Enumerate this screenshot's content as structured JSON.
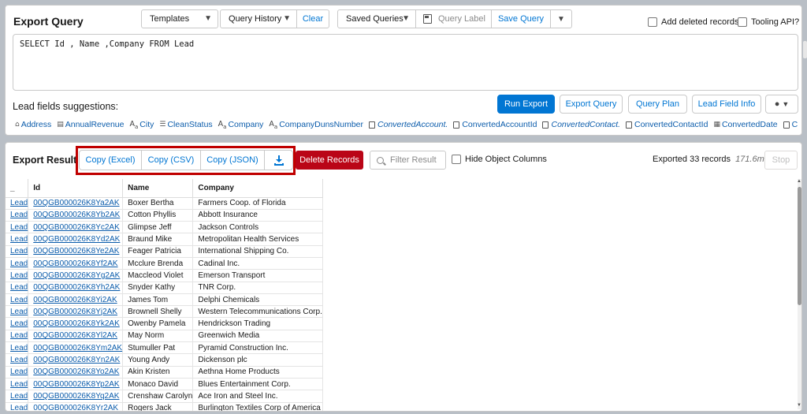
{
  "header": {
    "title": "Export Query",
    "templates": "Templates",
    "query_history": "Query History",
    "clear": "Clear",
    "saved_queries": "Saved Queries",
    "query_label_placeholder": "Query Label",
    "save_query": "Save Query",
    "add_deleted": "Add deleted records?",
    "tooling_api": "Tooling API?"
  },
  "editor": {
    "query": "SELECT Id , Name ,Company FROM Lead"
  },
  "suggestions": {
    "title": "Lead fields suggestions:",
    "buttons": {
      "run_export": "Run Export",
      "export_query": "Export Query",
      "query_plan": "Query Plan",
      "lead_field_info": "Lead Field Info"
    },
    "fields": [
      {
        "label": "Address",
        "icon": "home-icon",
        "italic": false
      },
      {
        "label": "AnnualRevenue",
        "icon": "currency-icon",
        "italic": false
      },
      {
        "label": "City",
        "icon": "text-icon",
        "italic": false
      },
      {
        "label": "CleanStatus",
        "icon": "picklist-icon",
        "italic": false
      },
      {
        "label": "Company",
        "icon": "text-icon",
        "italic": false
      },
      {
        "label": "CompanyDunsNumber",
        "icon": "text-icon",
        "italic": false
      },
      {
        "label": "ConvertedAccount.",
        "icon": "reference-icon",
        "italic": true
      },
      {
        "label": "ConvertedAccountId",
        "icon": "reference-icon",
        "italic": false
      },
      {
        "label": "ConvertedContact.",
        "icon": "reference-icon",
        "italic": true
      },
      {
        "label": "ConvertedContactId",
        "icon": "reference-icon",
        "italic": false
      },
      {
        "label": "ConvertedDate",
        "icon": "date-icon",
        "italic": false
      },
      {
        "label": "C",
        "icon": "reference-icon",
        "italic": false
      }
    ]
  },
  "result": {
    "title": "Export Result",
    "copy_excel": "Copy (Excel)",
    "copy_csv": "Copy (CSV)",
    "copy_json": "Copy (JSON)",
    "delete_records": "Delete Records",
    "filter_placeholder": "Filter Result",
    "hide_object_columns": "Hide Object Columns",
    "status": "Exported 33 records",
    "time": "171.6ms",
    "stop": "Stop",
    "columns": [
      "_",
      "Id",
      "Name",
      "Company"
    ],
    "rows": [
      [
        "Lead",
        "00QGB000026K8Ya2AK",
        "Boxer Bertha",
        "Farmers Coop. of Florida"
      ],
      [
        "Lead",
        "00QGB000026K8Yb2AK",
        "Cotton Phyllis",
        "Abbott Insurance"
      ],
      [
        "Lead",
        "00QGB000026K8Yc2AK",
        "Glimpse Jeff",
        "Jackson Controls"
      ],
      [
        "Lead",
        "00QGB000026K8Yd2AK",
        "Braund Mike",
        "Metropolitan Health Services"
      ],
      [
        "Lead",
        "00QGB000026K8Ye2AK",
        "Feager Patricia",
        "International Shipping Co."
      ],
      [
        "Lead",
        "00QGB000026K8Yf2AK",
        "Mcclure Brenda",
        "Cadinal Inc."
      ],
      [
        "Lead",
        "00QGB000026K8Yg2AK",
        "Maccleod Violet",
        "Emerson Transport"
      ],
      [
        "Lead",
        "00QGB000026K8Yh2AK",
        "Snyder Kathy",
        "TNR Corp."
      ],
      [
        "Lead",
        "00QGB000026K8Yi2AK",
        "James Tom",
        "Delphi Chemicals"
      ],
      [
        "Lead",
        "00QGB000026K8Yj2AK",
        "Brownell Shelly",
        "Western Telecommunications Corp."
      ],
      [
        "Lead",
        "00QGB000026K8Yk2AK",
        "Owenby Pamela",
        "Hendrickson Trading"
      ],
      [
        "Lead",
        "00QGB000026K8Yl2AK",
        "May Norm",
        "Greenwich Media"
      ],
      [
        "Lead",
        "00QGB000026K8Ym2AK",
        "Stumuller Pat",
        "Pyramid Construction Inc."
      ],
      [
        "Lead",
        "00QGB000026K8Yn2AK",
        "Young Andy",
        "Dickenson plc"
      ],
      [
        "Lead",
        "00QGB000026K8Yo2AK",
        "Akin Kristen",
        "Aethna Home Products"
      ],
      [
        "Lead",
        "00QGB000026K8Yp2AK",
        "Monaco David",
        "Blues Entertainment Corp."
      ],
      [
        "Lead",
        "00QGB000026K8Yq2AK",
        "Crenshaw Carolyn",
        "Ace Iron and Steel Inc."
      ],
      [
        "Lead",
        "00QGB000026K8Yr2AK",
        "Rogers Jack",
        "Burlington Textiles Corp of America"
      ]
    ]
  }
}
